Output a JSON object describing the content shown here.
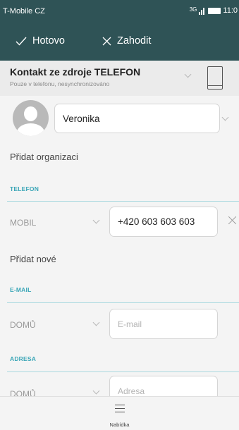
{
  "status_bar": {
    "carrier": "T-Mobile CZ",
    "network": "3G",
    "time": "11:0"
  },
  "action_bar": {
    "done_label": "Hotovo",
    "discard_label": "Zahodit"
  },
  "account_source": {
    "title": "Kontakt ze zdroje TELEFON",
    "subtitle": "Pouze v telefonu, nesynchronizováno"
  },
  "name_field": {
    "value": "Veronika"
  },
  "add_organization": "Přidat organizaci",
  "phone_section": {
    "header": "TELEFON",
    "type_label": "MOBIL",
    "value": "+420 603 603 603",
    "add_new": "Přidat nové"
  },
  "email_section": {
    "header": "E-MAIL",
    "type_label": "DOMŮ",
    "placeholder": "E-mail"
  },
  "address_section": {
    "header": "ADRESA",
    "type_label": "DOMŮ",
    "placeholder": "Adresa"
  },
  "bottom_bar": {
    "menu_label": "Nabídka"
  },
  "colors": {
    "header_bg": "#2f5356",
    "accent": "#3ba6b7"
  }
}
